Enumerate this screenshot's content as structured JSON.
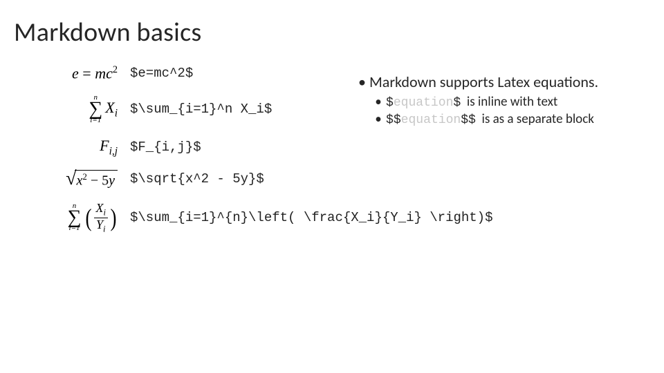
{
  "title": "Markdown basics",
  "rows": [
    {
      "render_key": "emc2",
      "tex": "$e=mc^2$"
    },
    {
      "render_key": "sumxi",
      "tex": "$\\sum_{i=1}^n X_i$"
    },
    {
      "render_key": "fij",
      "tex": "$F_{i,j}$"
    },
    {
      "render_key": "sqrt",
      "tex": "$\\sqrt{x^2 - 5y}$"
    },
    {
      "render_key": "frac",
      "tex": "$\\sum_{i=1}^{n}\\left( \\frac{X_i}{Y_i} \\right)$"
    }
  ],
  "notes": {
    "main": "Markdown supports Latex equations.",
    "inline_pre": "$",
    "inline_mid": "equation",
    "inline_post": "$",
    "inline_desc": "is inline with text",
    "block_pre": "$$",
    "block_mid": "equation",
    "block_post": "$$",
    "block_desc": "is as a separate block"
  }
}
